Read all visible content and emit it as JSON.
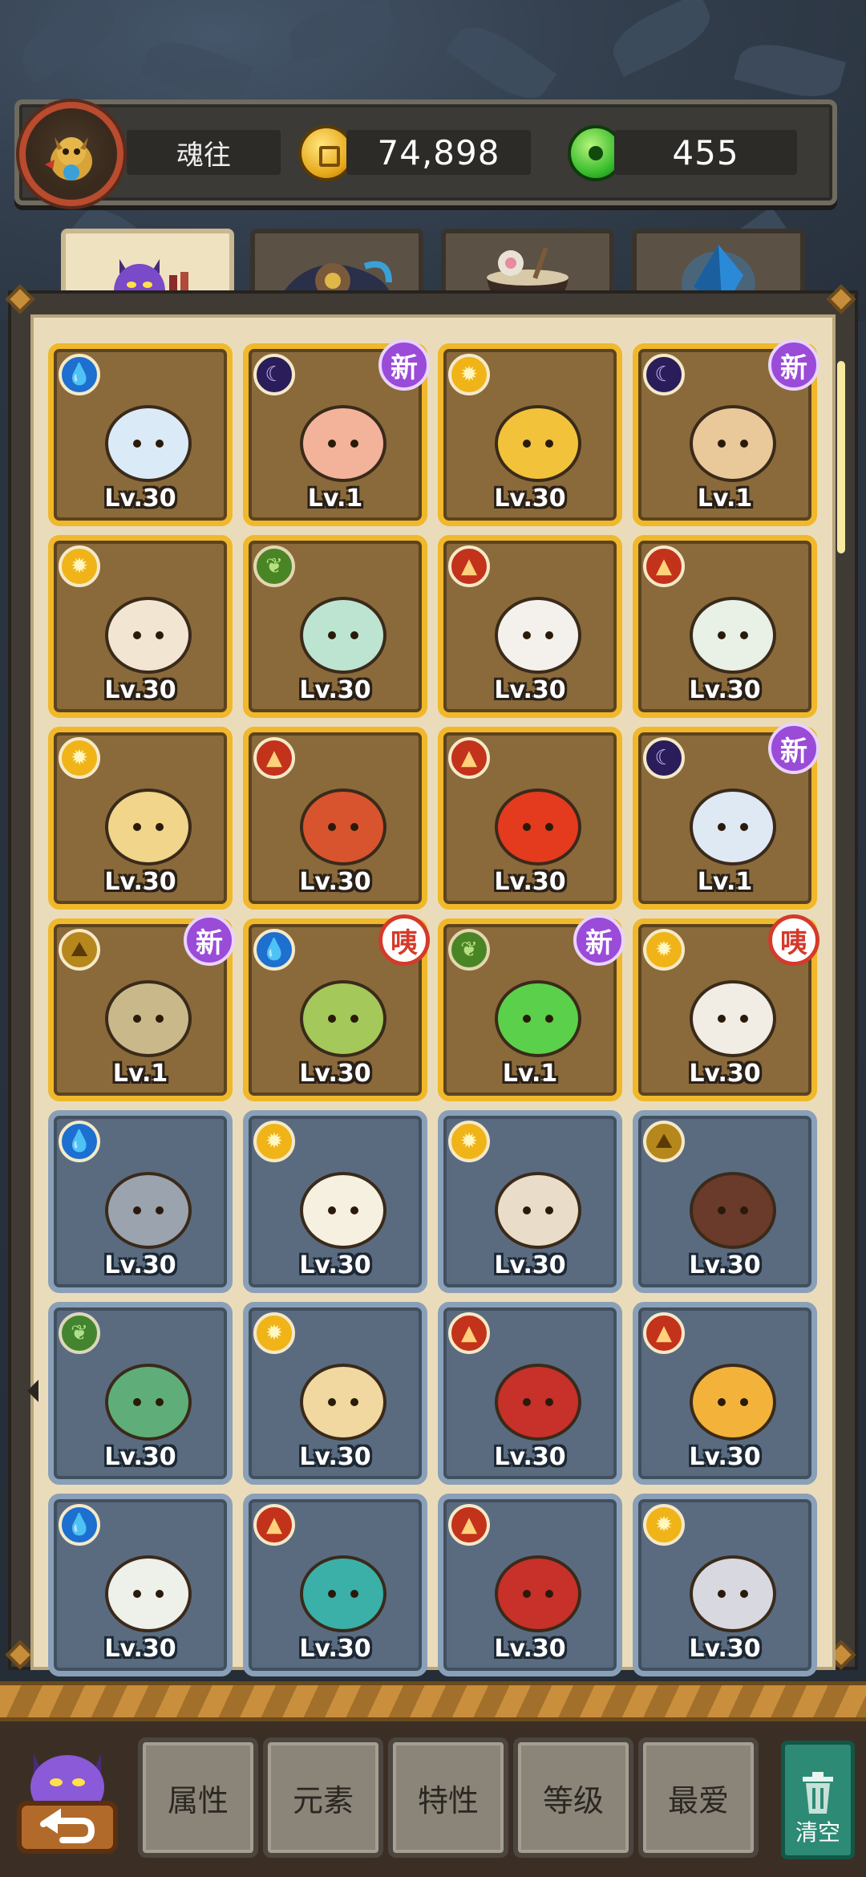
{
  "player": {
    "name": "魂往",
    "gold": "74,898",
    "jade": "455"
  },
  "tabs": [
    {
      "icon": "purple-monster-icon",
      "active": true
    },
    {
      "icon": "gear-hat-icon",
      "active": false
    },
    {
      "icon": "bowl-icon",
      "active": false
    },
    {
      "icon": "crystal-icon",
      "active": false
    }
  ],
  "cards": [
    {
      "frame": "gold",
      "element": "water",
      "badge": "",
      "level": "Lv.30",
      "pet": "ice-fairy-icon"
    },
    {
      "frame": "gold",
      "element": "dark",
      "badge": "新",
      "level": "Lv.1",
      "pet": "box-creature-icon"
    },
    {
      "frame": "gold",
      "element": "light",
      "badge": "",
      "level": "Lv.30",
      "pet": "gold-ingot-icon"
    },
    {
      "frame": "gold",
      "element": "dark",
      "badge": "新",
      "level": "Lv.1",
      "pet": "scholar-icon"
    },
    {
      "frame": "gold",
      "element": "light",
      "badge": "",
      "level": "Lv.30",
      "pet": "ghost-icon"
    },
    {
      "frame": "gold",
      "element": "leaf",
      "badge": "",
      "level": "Lv.30",
      "pet": "ruyi-sprite-icon"
    },
    {
      "frame": "gold",
      "element": "fire",
      "badge": "",
      "level": "Lv.30",
      "pet": "gift-box-icon"
    },
    {
      "frame": "gold",
      "element": "fire",
      "badge": "",
      "level": "Lv.30",
      "pet": "mahjong-tile-icon"
    },
    {
      "frame": "gold",
      "element": "light",
      "badge": "",
      "level": "Lv.30",
      "pet": "drill-shell-icon"
    },
    {
      "frame": "gold",
      "element": "fire",
      "badge": "",
      "level": "Lv.30",
      "pet": "red-ball-icon"
    },
    {
      "frame": "gold",
      "element": "fire",
      "badge": "",
      "level": "Lv.30",
      "pet": "fire-bird-icon"
    },
    {
      "frame": "gold",
      "element": "dark",
      "badge": "新",
      "level": "Lv.1",
      "pet": "salt-spoon-icon"
    },
    {
      "frame": "gold",
      "element": "earth",
      "badge": "新",
      "level": "Lv.1",
      "pet": "pipe-bag-icon"
    },
    {
      "frame": "gold",
      "element": "water",
      "badge": "咦",
      "level": "Lv.30",
      "pet": "bamboo-icon"
    },
    {
      "frame": "gold",
      "element": "leaf",
      "badge": "新",
      "level": "Lv.1",
      "pet": "green-slime-icon"
    },
    {
      "frame": "gold",
      "element": "light",
      "badge": "咦",
      "level": "Lv.30",
      "pet": "feather-pen-icon"
    },
    {
      "frame": "blue",
      "element": "water",
      "badge": "",
      "level": "Lv.30",
      "pet": "ice-cat-icon"
    },
    {
      "frame": "blue",
      "element": "light",
      "badge": "",
      "level": "Lv.30",
      "pet": "hourglass-icon"
    },
    {
      "frame": "blue",
      "element": "light",
      "badge": "",
      "level": "Lv.30",
      "pet": "red-blanket-icon"
    },
    {
      "frame": "blue",
      "element": "earth",
      "badge": "",
      "level": "Lv.30",
      "pet": "chestnut-icon"
    },
    {
      "frame": "blue",
      "element": "leaf",
      "badge": "",
      "level": "Lv.30",
      "pet": "green-dino-icon"
    },
    {
      "frame": "blue",
      "element": "light",
      "badge": "",
      "level": "Lv.30",
      "pet": "xiangqi-piece-icon"
    },
    {
      "frame": "blue",
      "element": "fire",
      "badge": "",
      "level": "Lv.30",
      "pet": "red-banner-icon"
    },
    {
      "frame": "blue",
      "element": "fire",
      "badge": "",
      "level": "Lv.30",
      "pet": "propeller-cat-icon"
    },
    {
      "frame": "blue",
      "element": "water",
      "badge": "",
      "level": "Lv.30",
      "pet": "white-bun-icon"
    },
    {
      "frame": "blue",
      "element": "fire",
      "badge": "",
      "level": "Lv.30",
      "pet": "teal-hair-girl-icon"
    },
    {
      "frame": "blue",
      "element": "fire",
      "badge": "",
      "level": "Lv.30",
      "pet": "red-hedgehog-icon"
    },
    {
      "frame": "blue",
      "element": "light",
      "badge": "",
      "level": "Lv.30",
      "pet": "white-rabbit-icon"
    }
  ],
  "filters": [
    "属性",
    "元素",
    "特性",
    "等级",
    "最爱"
  ],
  "clear_label": "清空",
  "colors": {
    "gold_frame": "#f0b82a",
    "blue_frame": "#8aa0b8",
    "new_badge": "#9a4bd8",
    "panel": "#eadcbb"
  }
}
